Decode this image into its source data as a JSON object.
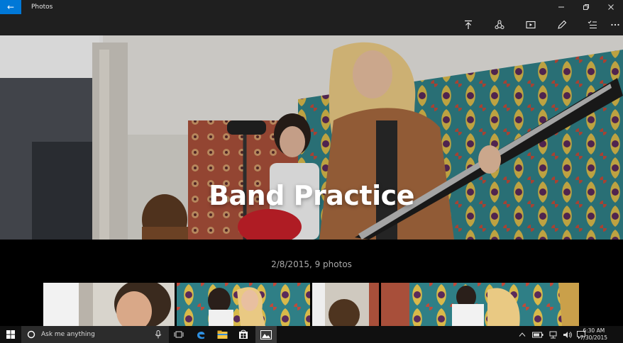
{
  "window": {
    "app_title": "Photos"
  },
  "album": {
    "title": "Band Practice",
    "meta": "2/8/2015, 9 photos"
  },
  "taskbar": {
    "search_placeholder": "Ask me anything",
    "time": "6:30 AM",
    "date": "7/30/2015"
  },
  "colors": {
    "accent": "#0078d7"
  }
}
